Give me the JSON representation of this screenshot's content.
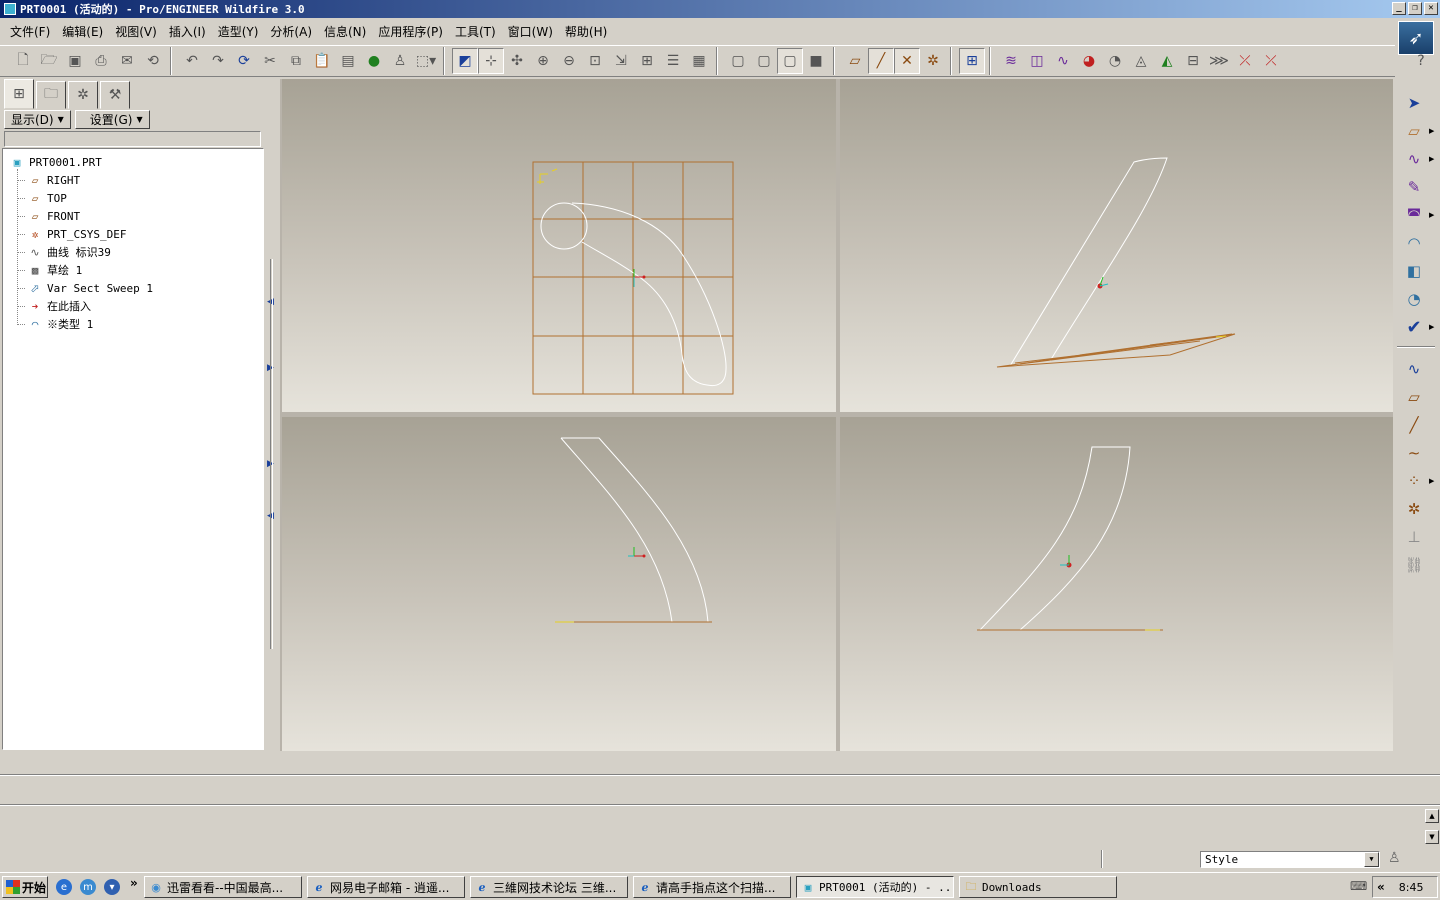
{
  "window": {
    "title": "PRT0001 (活动的) - Pro/ENGINEER Wildfire 3.0",
    "controls": [
      "_",
      "❐",
      "✕"
    ]
  },
  "menu": [
    "文件(F)",
    "编辑(E)",
    "视图(V)",
    "插入(I)",
    "造型(Y)",
    "分析(A)",
    "信息(N)",
    "应用程序(P)",
    "工具(T)",
    "窗口(W)",
    "帮助(H)"
  ],
  "panel": {
    "show_menu": "显示(D)",
    "settings_menu": "设置(G)"
  },
  "model_tree": {
    "root": "PRT0001.PRT",
    "items": [
      {
        "label": "RIGHT",
        "icon": "datum-plane-icon"
      },
      {
        "label": "TOP",
        "icon": "datum-plane-icon"
      },
      {
        "label": "FRONT",
        "icon": "datum-plane-icon"
      },
      {
        "label": "PRT_CSYS_DEF",
        "icon": "csys-icon"
      },
      {
        "label": "曲线 标识39",
        "icon": "curve-icon"
      },
      {
        "label": "草绘 1",
        "icon": "sketch-icon"
      },
      {
        "label": "Var Sect Sweep 1",
        "icon": "sweep-icon"
      },
      {
        "label": "在此插入",
        "icon": "insert-here-arrow-icon"
      },
      {
        "label": "※类型 1",
        "icon": "surface-feature-icon"
      }
    ]
  },
  "status": {
    "filter_value": "Style"
  },
  "taskbar": {
    "start_label": "开始",
    "tasks": [
      {
        "label": "迅雷看看--中国最高...",
        "icon": "thunder-icon"
      },
      {
        "label": "网易电子邮箱 - 逍遥...",
        "icon": "ie-icon"
      },
      {
        "label": "三維网技术论坛 三维...",
        "icon": "ie-icon"
      },
      {
        "label": "请高手指点这个扫描...",
        "icon": "ie-icon"
      },
      {
        "label": "PRT0001 (活动的) - ...",
        "icon": "proe-icon"
      },
      {
        "label": "Downloads",
        "icon": "folder-icon"
      }
    ],
    "clock": "8:45"
  },
  "colors": {
    "title_gradient_start": "#0a246a",
    "datum_brown": "#b07030",
    "curve_white": "#ffffff",
    "viewport_top": "#a7a295",
    "viewport_bottom": "#e6e3db"
  }
}
